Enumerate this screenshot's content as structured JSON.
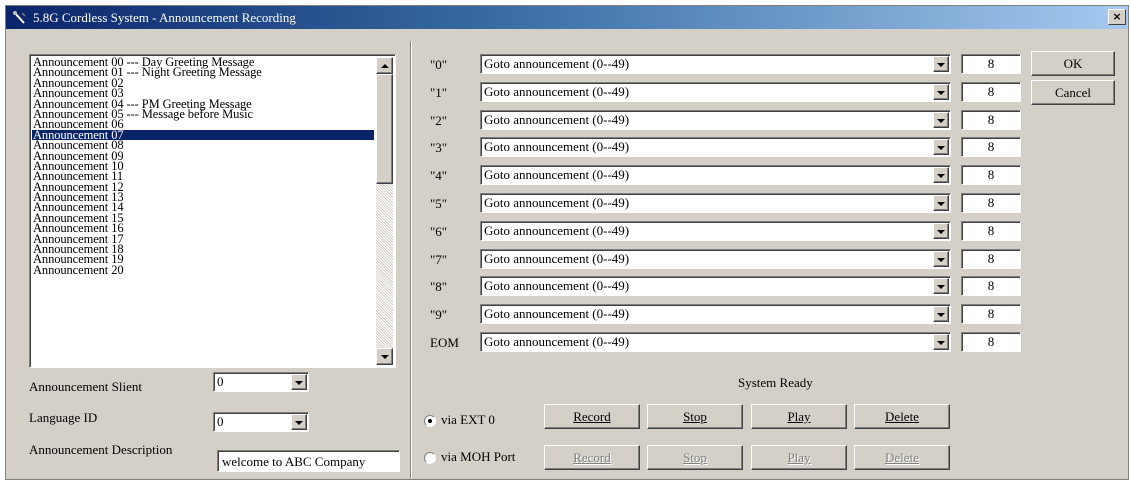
{
  "window": {
    "title": "5.8G Cordless System - Announcement Recording",
    "close": "×"
  },
  "announcements": [
    "Announcement 00 --- Day Greeting Message",
    "Announcement 01 --- Night Greeting Message",
    "Announcement 02",
    "Announcement 03",
    "Announcement 04 --- PM Greeting Message",
    "Announcement 05 --- Message before Music",
    "Announcement 06",
    "Announcement 07",
    "Announcement 08",
    "Announcement 09",
    "Announcement 10",
    "Announcement 11",
    "Announcement 12",
    "Announcement 13",
    "Announcement 14",
    "Announcement 15",
    "Announcement 16",
    "Announcement 17",
    "Announcement 18",
    "Announcement 19",
    "Announcement 20"
  ],
  "selected_index": 7,
  "fields": {
    "silent_label": "Announcement Slient",
    "silent_value": "0",
    "language_label": "Language ID",
    "language_value": "0",
    "description_label": "Announcement Description",
    "description_value": "welcome to ABC Company"
  },
  "keys": [
    {
      "key": "\"0\"",
      "action": "Goto announcement (0--49)",
      "value": "8"
    },
    {
      "key": "\"1\"",
      "action": "Goto announcement (0--49)",
      "value": "8"
    },
    {
      "key": "\"2\"",
      "action": "Goto announcement (0--49)",
      "value": "8"
    },
    {
      "key": "\"3\"",
      "action": "Goto announcement (0--49)",
      "value": "8"
    },
    {
      "key": "\"4\"",
      "action": "Goto announcement (0--49)",
      "value": "8"
    },
    {
      "key": "\"5\"",
      "action": "Goto announcement (0--49)",
      "value": "8"
    },
    {
      "key": "\"6\"",
      "action": "Goto announcement (0--49)",
      "value": "8"
    },
    {
      "key": "\"7\"",
      "action": "Goto announcement (0--49)",
      "value": "8"
    },
    {
      "key": "\"8\"",
      "action": "Goto announcement (0--49)",
      "value": "8"
    },
    {
      "key": "\"9\"",
      "action": "Goto announcement (0--49)",
      "value": "8"
    },
    {
      "key": "EOM",
      "action": "Goto announcement (0--49)",
      "value": "8"
    }
  ],
  "buttons": {
    "ok": "OK",
    "cancel": "Cancel"
  },
  "status": "System Ready",
  "source_ext": {
    "label": "via EXT 0",
    "selected": true,
    "record": "Record",
    "stop": "Stop",
    "play": "Play",
    "delete": "Delete"
  },
  "source_moh": {
    "label": "via MOH Port",
    "selected": false,
    "record": "Record",
    "stop": "Stop",
    "play": "Play",
    "delete": "Delete"
  },
  "icons": [
    "app-icon",
    "close-icon",
    "scroll-up-icon",
    "scroll-down-icon",
    "dropdown-arrow-icon"
  ]
}
